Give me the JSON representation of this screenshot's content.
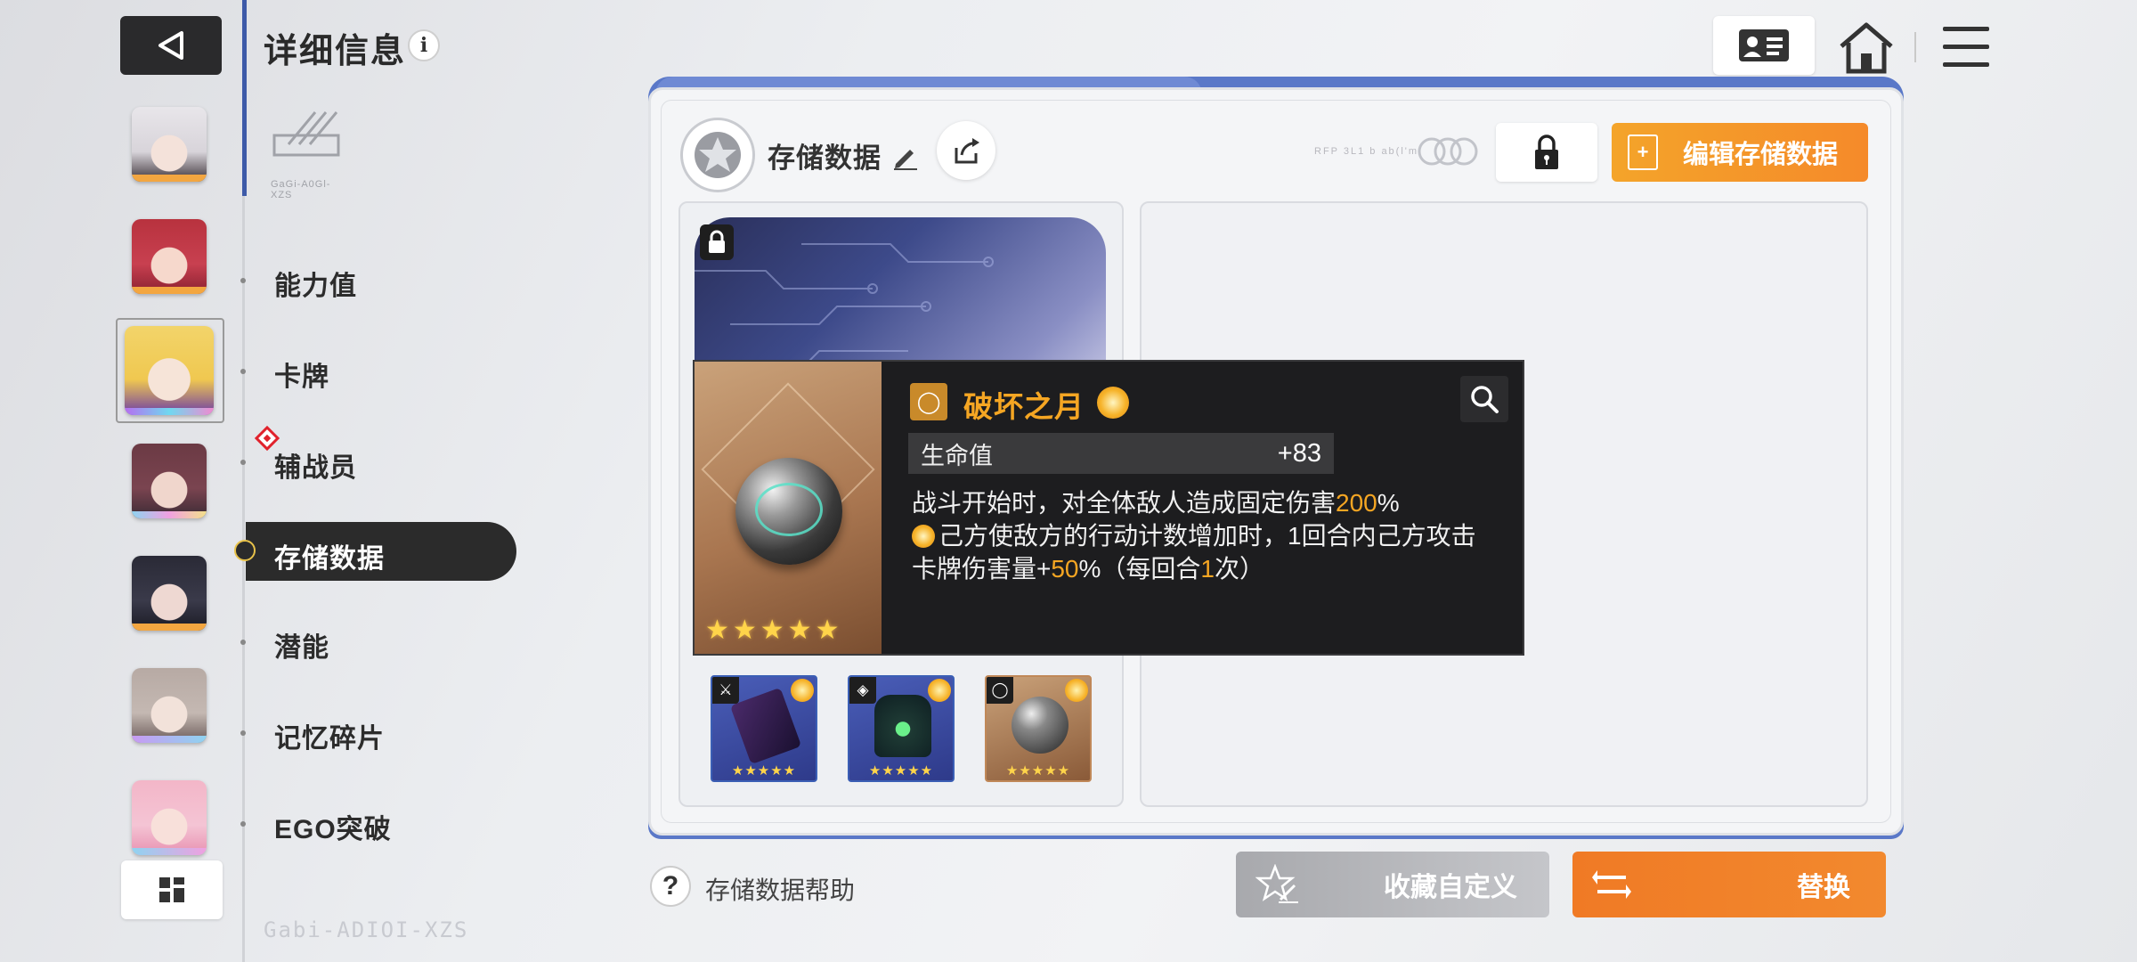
{
  "header": {
    "title": "详细信息",
    "info_glyph": "i"
  },
  "nav": {
    "items": [
      {
        "label": "能力值"
      },
      {
        "label": "卡牌"
      },
      {
        "label": "辅战员"
      },
      {
        "label": "存储数据"
      },
      {
        "label": "潜能"
      },
      {
        "label": "记忆碎片"
      },
      {
        "label": "EGO突破"
      }
    ],
    "active": "存储数据"
  },
  "characters": [
    {
      "name": "avatar-1",
      "accent": "#f3a640",
      "skin": "#f4e2da",
      "hair": "#e8e6ea"
    },
    {
      "name": "avatar-2",
      "accent": "#f3a640",
      "skin": "#f6d8cc",
      "hair": "#b8323e"
    },
    {
      "name": "avatar-3",
      "accent": "#b66ef0",
      "skin": "#f6e4d8",
      "hair": "#f2d46a"
    },
    {
      "name": "avatar-4",
      "accent": "#8fd3f0",
      "skin": "#f0d6cc",
      "hair": "#6b3a44"
    },
    {
      "name": "avatar-5",
      "accent": "#f3a640",
      "skin": "#eed8d2",
      "hair": "#2a2a36"
    },
    {
      "name": "avatar-6",
      "accent": "#c89af2",
      "skin": "#f2e2da",
      "hair": "#b7aaa4"
    },
    {
      "name": "avatar-7",
      "accent": "#8fd3f0",
      "skin": "#f8e0da",
      "hair": "#f3b6c8"
    }
  ],
  "logo_caption": "GaGi-A0Gl-XZS",
  "watermark": "Gabi-ADIOI-XZS",
  "panel": {
    "title": "存储数据",
    "deco_text": "RFP 3L1 b ab(l'm.",
    "edit_label": "编辑存储数据"
  },
  "equipment": [
    {
      "slot": "weapon",
      "stars": "★★★★★",
      "type_glyph": "⚔"
    },
    {
      "slot": "armor",
      "stars": "★★★★★",
      "type_glyph": "◈"
    },
    {
      "slot": "ring",
      "stars": "★★★★★",
      "type_glyph": "◯"
    }
  ],
  "tooltip": {
    "item_name": "破坏之月",
    "stars": "★★★★★",
    "stat_label": "生命值",
    "stat_value": "+83",
    "desc_line1_a": "战斗开始时，对全体敌人造成固定伤害",
    "desc_line1_hl": "200",
    "desc_line1_b": "%",
    "desc_line2_a": "己方使敌方的行动计数增加时，",
    "desc_line2_hl1": "1",
    "desc_line2_b": "回合内己方攻击卡牌伤害量+",
    "desc_line2_hl2": "50",
    "desc_line2_c": "%（每回合",
    "desc_line2_hl3": "1",
    "desc_line2_d": "次）"
  },
  "footer": {
    "help_glyph": "?",
    "help_label": "存储数据帮助",
    "favorite_label": "收藏自定义",
    "replace_label": "替换"
  },
  "colors": {
    "accent_orange": "#f58a2a",
    "panel_blue": "#5a78c8",
    "gold": "#f5a623"
  }
}
